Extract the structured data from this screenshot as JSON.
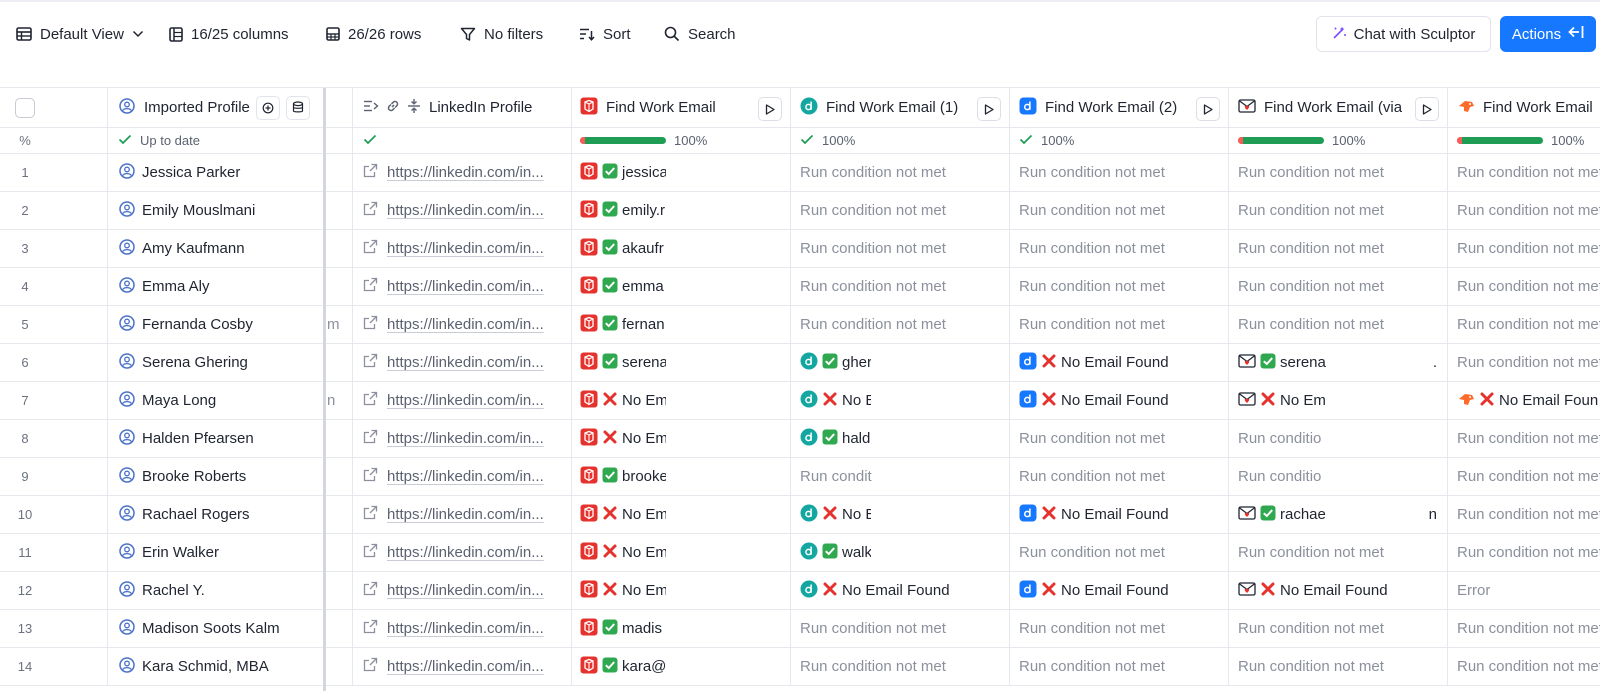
{
  "toolbar": {
    "view_label": "Default View",
    "columns_label": "16/25 columns",
    "rows_label": "26/26 rows",
    "filters_label": "No filters",
    "sort_label": "Sort",
    "search_label": "Search",
    "chat_label": "Chat with Sculptor",
    "actions_label": "Actions"
  },
  "columns": {
    "imported_profile": "Imported Profile",
    "linkedin_profile": "LinkedIn Profile",
    "find_work_email": "Find Work Email",
    "find_work_email_1": "Find Work Email (1)",
    "find_work_email_2": "Find Work Email (2)",
    "find_work_email_via": "Find Work Email (via",
    "find_work_email_last": "Find Work Email"
  },
  "status_row": {
    "rownum_label": "%",
    "imported_status": "Up to date",
    "find_email_progress": "100%",
    "find_email_1_progress": "100%",
    "find_email_2_progress": "100%",
    "find_email_via_progress": "100%",
    "find_email_last_progress": "100%"
  },
  "colors": {
    "accent": "#1677ff",
    "progress": "#1f9d55",
    "error": "#e5322d",
    "success": "#2fa84f"
  },
  "rows": [
    {
      "num": "1",
      "name": "Jessica Parker",
      "frag": "",
      "link": "https://linkedin.com/in...",
      "e0": {
        "ok": true,
        "text": "jessica"
      },
      "e1": {
        "muted": "Run condition not met"
      },
      "e2": {
        "muted": "Run condition not met"
      },
      "e3": {
        "muted": "Run condition not met"
      },
      "e4": {
        "muted": "Run condition not met"
      }
    },
    {
      "num": "2",
      "name": "Emily Mouslmani",
      "frag": "",
      "link": "https://linkedin.com/in...",
      "e0": {
        "ok": true,
        "text": "emily.r"
      },
      "e1": {
        "muted": "Run condition not met"
      },
      "e2": {
        "muted": "Run condition not met"
      },
      "e3": {
        "muted": "Run condition not met"
      },
      "e4": {
        "muted": "Run condition not met"
      }
    },
    {
      "num": "3",
      "name": "Amy Kaufmann",
      "frag": "",
      "link": "https://linkedin.com/in...",
      "e0": {
        "ok": true,
        "text": "akaufr"
      },
      "e1": {
        "muted": "Run condition not met"
      },
      "e2": {
        "muted": "Run condition not met"
      },
      "e3": {
        "muted": "Run condition not met"
      },
      "e4": {
        "muted": "Run condition not met"
      }
    },
    {
      "num": "4",
      "name": "Emma Aly",
      "frag": "",
      "link": "https://linkedin.com/in...",
      "e0": {
        "ok": true,
        "text": "emma"
      },
      "e1": {
        "muted": "Run condition not met"
      },
      "e2": {
        "muted": "Run condition not met"
      },
      "e3": {
        "muted": "Run condition not met"
      },
      "e4": {
        "muted": "Run condition not met"
      }
    },
    {
      "num": "5",
      "name": "Fernanda Cosby",
      "frag": "m",
      "link": "https://linkedin.com/in...",
      "e0": {
        "ok": true,
        "text": "fernan"
      },
      "e1": {
        "muted": "Run condition not met"
      },
      "e2": {
        "muted": "Run condition not met"
      },
      "e3": {
        "muted": "Run condition not met"
      },
      "e4": {
        "muted": "Run condition not met"
      }
    },
    {
      "num": "6",
      "name": "Serena Ghering",
      "frag": "",
      "link": "https://linkedin.com/in...",
      "e0": {
        "ok": true,
        "text": "serena"
      },
      "e1": {
        "ok": true,
        "text": "gheri"
      },
      "e2": {
        "ok": false,
        "text": "No Email Found"
      },
      "e3": {
        "ok": true,
        "text": "serena",
        "tail": "."
      },
      "e4": {
        "muted": "Run condition not met"
      }
    },
    {
      "num": "7",
      "name": "Maya Long",
      "frag": "n",
      "link": "https://linkedin.com/in...",
      "e0": {
        "ok": false,
        "text": "No Em"
      },
      "e1": {
        "ok": false,
        "text": "No Er"
      },
      "e2": {
        "ok": false,
        "text": "No Email Found"
      },
      "e3": {
        "ok": false,
        "text": "No Em"
      },
      "e4": {
        "ok": false,
        "text": "No Email Foun"
      }
    },
    {
      "num": "8",
      "name": "Halden Pfearsen",
      "frag": "",
      "link": "https://linkedin.com/in...",
      "e0": {
        "ok": false,
        "text": "No Em"
      },
      "e1": {
        "ok": true,
        "text": "halde"
      },
      "e2": {
        "muted": "Run condition not met"
      },
      "e3": {
        "muted": "Run conditio"
      },
      "e4": {
        "muted": "Run condition not met"
      }
    },
    {
      "num": "9",
      "name": "Brooke Roberts",
      "frag": "",
      "link": "https://linkedin.com/in...",
      "e0": {
        "ok": true,
        "text": "brooke"
      },
      "e1": {
        "muted": "Run condit"
      },
      "e2": {
        "muted": "Run condition not met"
      },
      "e3": {
        "muted": "Run conditio"
      },
      "e4": {
        "muted": "Run condition not met"
      }
    },
    {
      "num": "10",
      "name": "Rachael Rogers",
      "frag": "",
      "link": "https://linkedin.com/in...",
      "e0": {
        "ok": false,
        "text": "No Em"
      },
      "e1": {
        "ok": false,
        "text": "No Er"
      },
      "e2": {
        "ok": false,
        "text": "No Email Found"
      },
      "e3": {
        "ok": true,
        "text": "rachae",
        "tail": "n"
      },
      "e4": {
        "muted": "Run condition not met"
      }
    },
    {
      "num": "11",
      "name": "Erin Walker",
      "frag": "",
      "link": "https://linkedin.com/in...",
      "e0": {
        "ok": false,
        "text": "No Em"
      },
      "e1": {
        "ok": true,
        "text": "walke"
      },
      "e2": {
        "muted": "Run condition not met"
      },
      "e3": {
        "muted": "Run condition not met"
      },
      "e4": {
        "muted": "Run condition not met"
      }
    },
    {
      "num": "12",
      "name": "Rachel Y.",
      "frag": "",
      "link": "https://linkedin.com/in...",
      "e0": {
        "ok": false,
        "text": "No Em"
      },
      "e1": {
        "ok": false,
        "text": "No Email Found"
      },
      "e2": {
        "ok": false,
        "text": "No Email Found"
      },
      "e3": {
        "ok": false,
        "text": "No Email Found"
      },
      "e4": {
        "muted": "Error"
      }
    },
    {
      "num": "13",
      "name": "Madison Soots Kalm",
      "frag": "",
      "link": "https://linkedin.com/in...",
      "e0": {
        "ok": true,
        "text": "madis"
      },
      "e1": {
        "muted": "Run condition not met"
      },
      "e2": {
        "muted": "Run condition not met"
      },
      "e3": {
        "muted": "Run condition not met"
      },
      "e4": {
        "muted": "Run condition not met"
      }
    },
    {
      "num": "14",
      "name": "Kara Schmid, MBA",
      "frag": "",
      "link": "https://linkedin.com/in...",
      "e0": {
        "ok": true,
        "text": "kara@"
      },
      "e1": {
        "muted": "Run condition not met"
      },
      "e2": {
        "muted": "Run condition not met"
      },
      "e3": {
        "muted": "Run condition not met"
      },
      "e4": {
        "muted": "Run condition not met"
      }
    }
  ]
}
